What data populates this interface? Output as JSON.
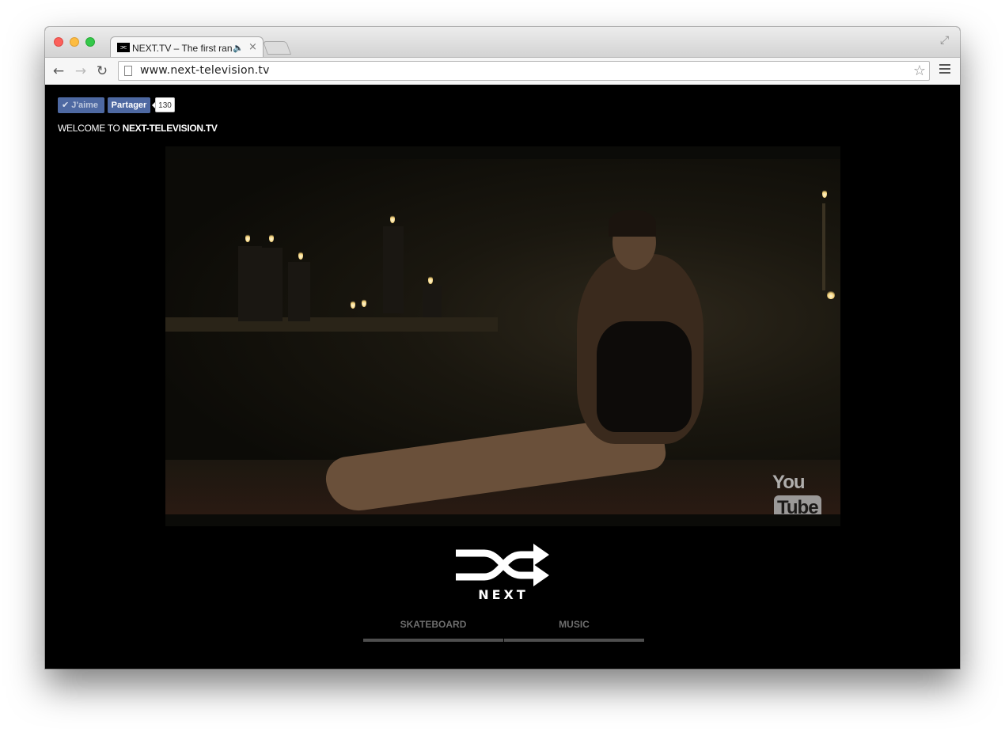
{
  "browser": {
    "tab_title": "NEXT.TV – The first random",
    "tab_favicon": "⫘",
    "tab_audio_icon": "speaker-icon",
    "url": "www.next-television.tv"
  },
  "facebook": {
    "like_label": "J'aime",
    "share_label": "Partager",
    "count": "130"
  },
  "page": {
    "welcome_prefix": "WELCOME TO ",
    "welcome_site": "NEXT-TELEVISION.TV",
    "logo_text": "NEXT"
  },
  "video": {
    "watermark_you": "You",
    "watermark_tube": "Tube"
  },
  "nav": {
    "items": [
      {
        "label": "SKATEBOARD"
      },
      {
        "label": "MUSIC"
      }
    ]
  },
  "colors": {
    "facebook_blue": "#4e69a2",
    "nav_underline": "#4e4e4e",
    "background": "#000000"
  }
}
